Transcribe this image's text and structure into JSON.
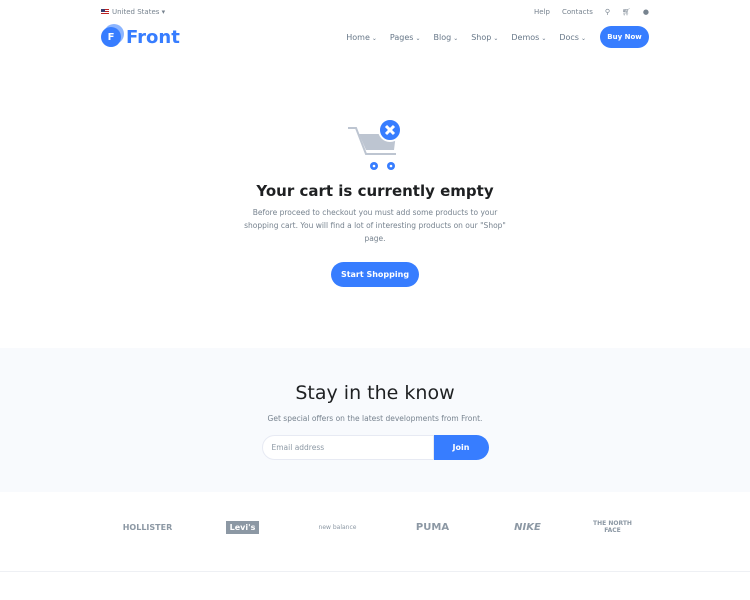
{
  "topbar": {
    "region": "United States",
    "links": [
      "Help",
      "Contacts"
    ]
  },
  "header": {
    "logo": "Front",
    "logo_letter": "F",
    "nav": [
      "Home",
      "Pages",
      "Blog",
      "Shop",
      "Demos",
      "Docs"
    ],
    "buy": "Buy Now"
  },
  "empty": {
    "title": "Your cart is currently empty",
    "text": "Before proceed to checkout you must add some products to your shopping cart. You will find a lot of interesting products on our \"Shop\" page.",
    "button": "Start Shopping"
  },
  "newsletter": {
    "title": "Stay in the know",
    "subtitle": "Get special offers on the latest developments from Front.",
    "placeholder": "Email address",
    "button": "Join"
  },
  "brands": [
    "HOLLISTER",
    "Levi's",
    "new balance",
    "PUMA",
    "NIKE",
    "THE NORTH FACE"
  ],
  "colors": {
    "primary": "#377dff"
  }
}
